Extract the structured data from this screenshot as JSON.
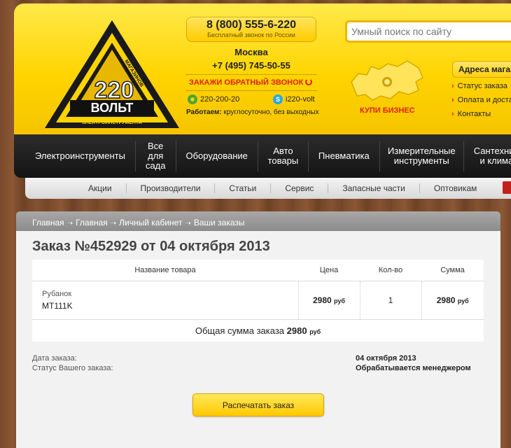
{
  "header": {
    "logo": {
      "main": "220",
      "brand": "ВОЛЬТ",
      "network": "СЕТЬ",
      "stores": "МАГАЗИНОВ",
      "tagline": "ЭЛЕКТРОИНСТРУМЕНТА"
    },
    "phone": "8 (800) 555-6-220",
    "phone_note": "Бесплатный звонок по России",
    "city": "Москва",
    "city_phone": "+7 (495) 745-50-55",
    "callback": "ЗАКАЖИ ОБРАТНЫЙ ЗВОНОК",
    "icq": "220-200-20",
    "skype": "i220-volt",
    "hours_label": "Работаем:",
    "hours_value": "круглосуточно, без выходных",
    "buy_business": "КУПИ БИЗНЕС",
    "search_placeholder": "Умный поиск по сайту",
    "addresses": "Адреса магазинов",
    "right_links": [
      "Статус заказа",
      "Оплата и доставка",
      "Контакты"
    ]
  },
  "nav": {
    "items": [
      "Электроинструменты",
      "Все для сада",
      "Оборудование",
      "Авто товары",
      "Пневматика",
      "Измерительные инструменты",
      "Сантехника и климат"
    ]
  },
  "subnav": {
    "items": [
      "Акции",
      "Производители",
      "Статьи",
      "Сервис",
      "Запасные части",
      "Оптовикам"
    ]
  },
  "breadcrumb": [
    "Главная",
    "Главная",
    "Личный кабинет",
    "Ваши заказы"
  ],
  "order": {
    "title": "Заказ №452929 от 04 октября 2013",
    "columns": {
      "name": "Название товара",
      "price": "Цена",
      "qty": "Кол-во",
      "sum": "Сумма"
    },
    "items": [
      {
        "category": "Рубанок",
        "model": "MT111K",
        "price": "2980",
        "currency": "руб",
        "qty": "1",
        "sum": "2980"
      }
    ],
    "total_label": "Общая сумма заказа",
    "total_value": "2980",
    "total_currency": "руб",
    "date_label": "Дата заказа:",
    "date_value": "04 октября 2013",
    "status_label": "Статус Вашего заказа:",
    "status_value": "Обрабатывается менеджером",
    "print_button": "Распечатать заказ"
  },
  "colors": {
    "accent_yellow": "#ffd400",
    "nav_dark": "#1c1c1c",
    "red": "#e02000"
  }
}
